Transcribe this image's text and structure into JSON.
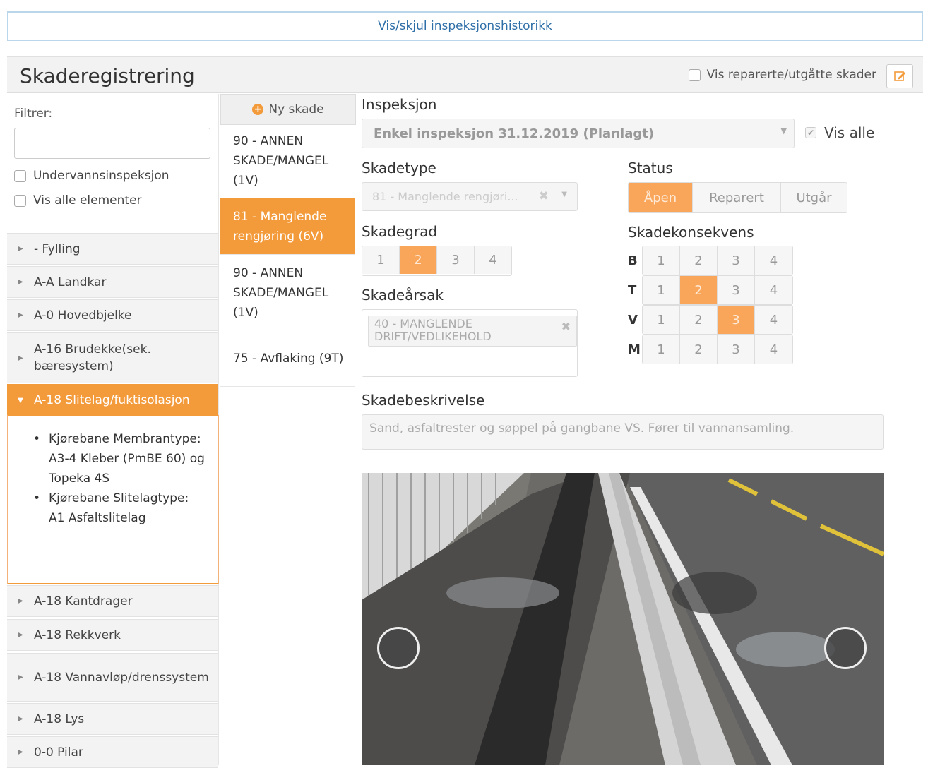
{
  "history_toggle": "Vis/skjul inspeksjonshistorikk",
  "header": {
    "title": "Skaderegistrering",
    "show_repaired": "Vis reparerte/utgåtte skader"
  },
  "sidebar": {
    "filter_label": "Filtrer:",
    "filter_value": "",
    "checks": [
      "Undervannsinspeksjon",
      "Vis alle elementer"
    ],
    "tree": [
      "- Fylling",
      "A-A Landkar",
      "A-0 Hovedbjelke",
      "A-16 Brudekke(sek. bæresystem)",
      "A-18 Slitelag/fuktisolasjon",
      "A-18 Kantdrager",
      "A-18 Rekkverk",
      "A-18 Vannavløp/drenssystem",
      "A-18 Lys",
      "0-0 Pilar"
    ],
    "expanded_details": [
      "Kjørebane Membrantype: A3-4 Kleber (PmBE 60) og Topeka 4S",
      "Kjørebane Slitelagtype: A1 Asfaltslitelag"
    ]
  },
  "damage_list": {
    "new_button": "Ny skade",
    "items": [
      "90 - ANNEN SKADE/MANGEL (1V)",
      "81 - Manglende rengjøring (6V)",
      "90 - ANNEN SKADE/MANGEL (1V)",
      "75 - Avflaking (9T)"
    ]
  },
  "form": {
    "inspection_label": "Inspeksjon",
    "inspection_value": "Enkel inspeksjon 31.12.2019 (Planlagt)",
    "vis_alle": "Vis alle",
    "skadetype_label": "Skadetype",
    "skadetype_value": "81 - Manglende rengjøri...",
    "status_label": "Status",
    "status_options": [
      "Åpen",
      "Reparert",
      "Utgår"
    ],
    "status_selected": "Åpen",
    "skadegrad_label": "Skadegrad",
    "grades": [
      "1",
      "2",
      "3",
      "4"
    ],
    "skadegrad_selected": 2,
    "skadekonsekvens_label": "Skadekonsekvens",
    "consequence_rows": [
      {
        "letter": "B",
        "selected": null
      },
      {
        "letter": "T",
        "selected": 2
      },
      {
        "letter": "V",
        "selected": 3
      },
      {
        "letter": "M",
        "selected": null
      }
    ],
    "skadearsak_label": "Skadeårsak",
    "skadearsak_value": "40 - MANGLENDE DRIFT/VEDLIKEHOLD",
    "beskrivelse_label": "Skadebeskrivelse",
    "beskrivelse_value": "Sand, asfaltrester og søppel på gangbane VS. Fører til vannansamling."
  },
  "colors": {
    "accent": "#f39a3a",
    "link": "#2f6fa8"
  }
}
